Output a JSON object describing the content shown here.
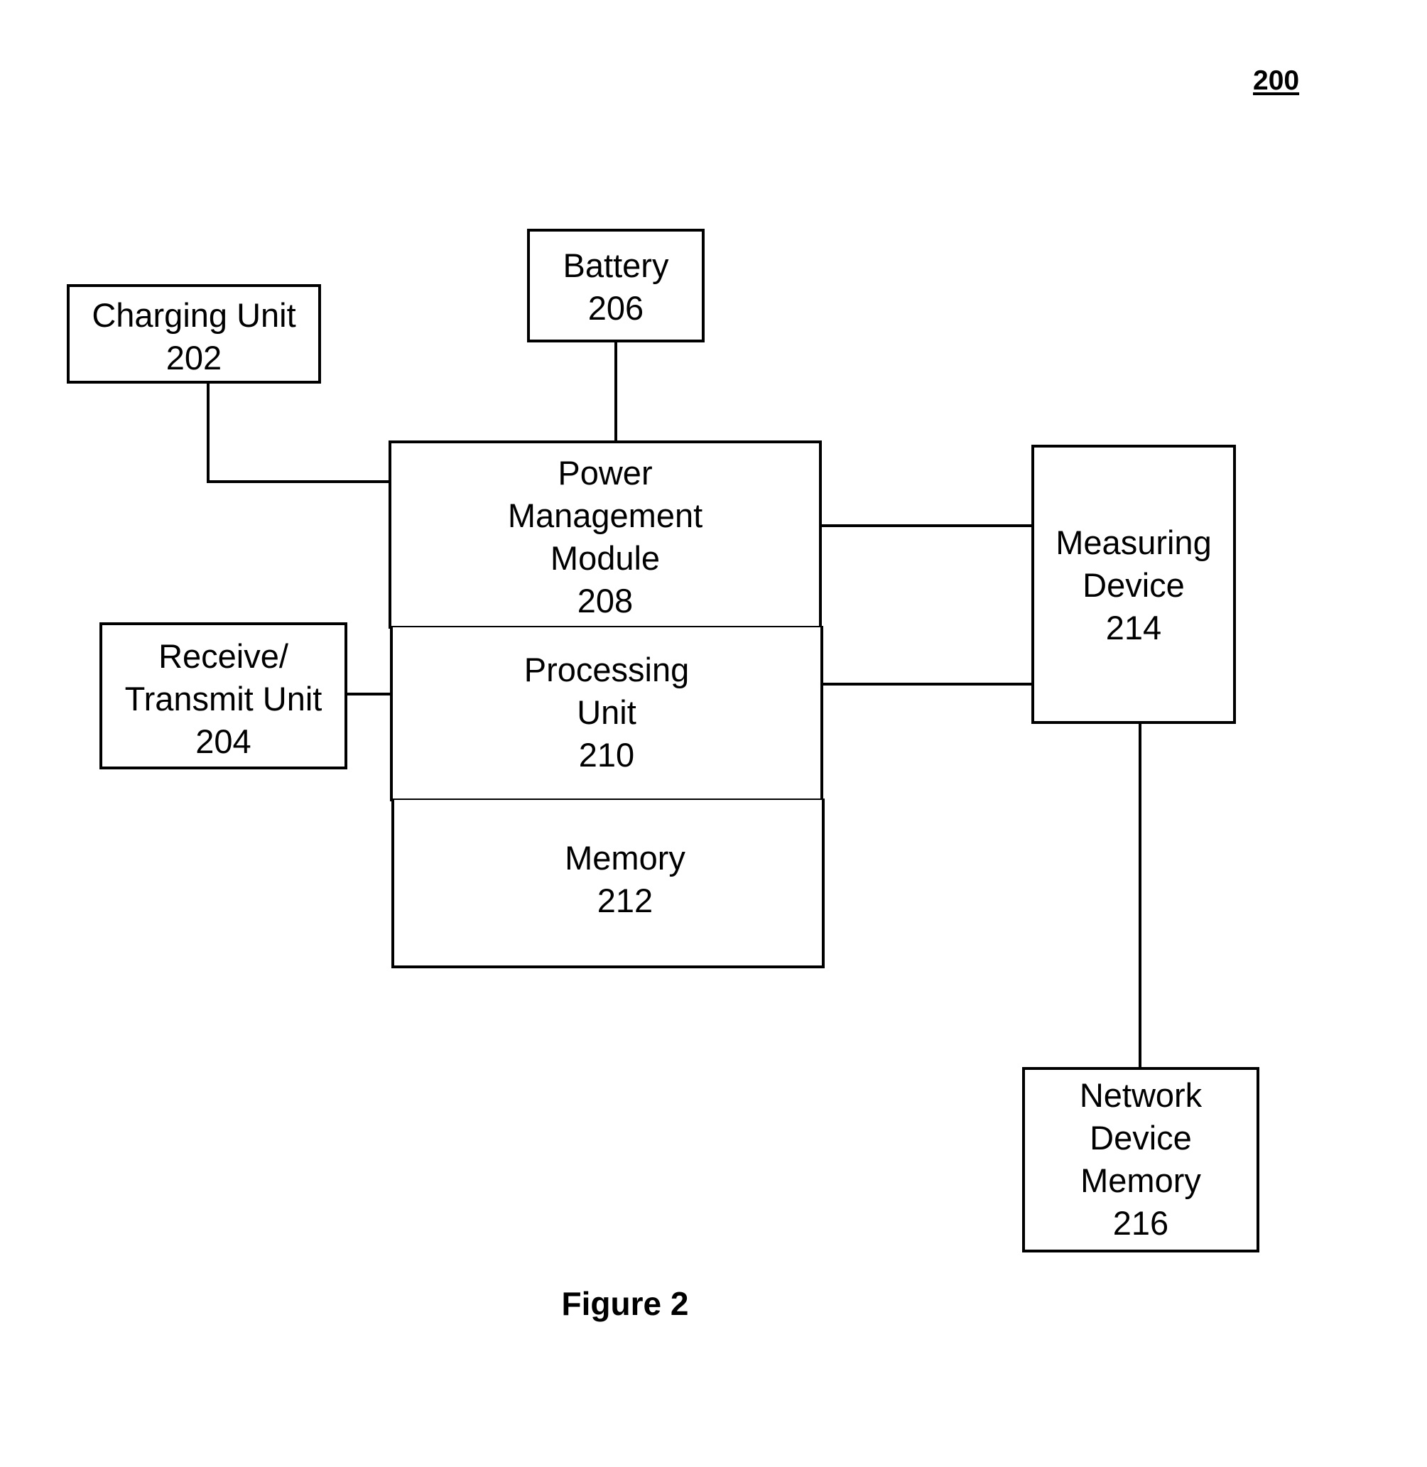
{
  "figure_number": "200",
  "caption": "Figure 2",
  "blocks": {
    "charging_unit": {
      "name": "Charging Unit",
      "ref": "202"
    },
    "receive_transmit_unit": {
      "name_line1": "Receive/",
      "name_line2": "Transmit Unit",
      "ref": "204"
    },
    "battery": {
      "name": "Battery",
      "ref": "206"
    },
    "power_management_module": {
      "name_line1": "Power",
      "name_line2": "Management",
      "name_line3": "Module",
      "ref": "208"
    },
    "processing_unit": {
      "name_line1": "Processing",
      "name_line2": "Unit",
      "ref": "210"
    },
    "memory": {
      "name": "Memory",
      "ref": "212"
    },
    "measuring_device": {
      "name_line1": "Measuring",
      "name_line2": "Device",
      "ref": "214"
    },
    "network_device_memory": {
      "name_line1": "Network",
      "name_line2": "Device",
      "name_line3": "Memory",
      "ref": "216"
    }
  },
  "connections": [
    {
      "from": "202",
      "to": "208"
    },
    {
      "from": "206",
      "to": "208"
    },
    {
      "from": "204",
      "to": "210"
    },
    {
      "from": "208",
      "to": "214"
    },
    {
      "from": "210",
      "to": "214"
    },
    {
      "from": "214",
      "to": "216"
    }
  ]
}
